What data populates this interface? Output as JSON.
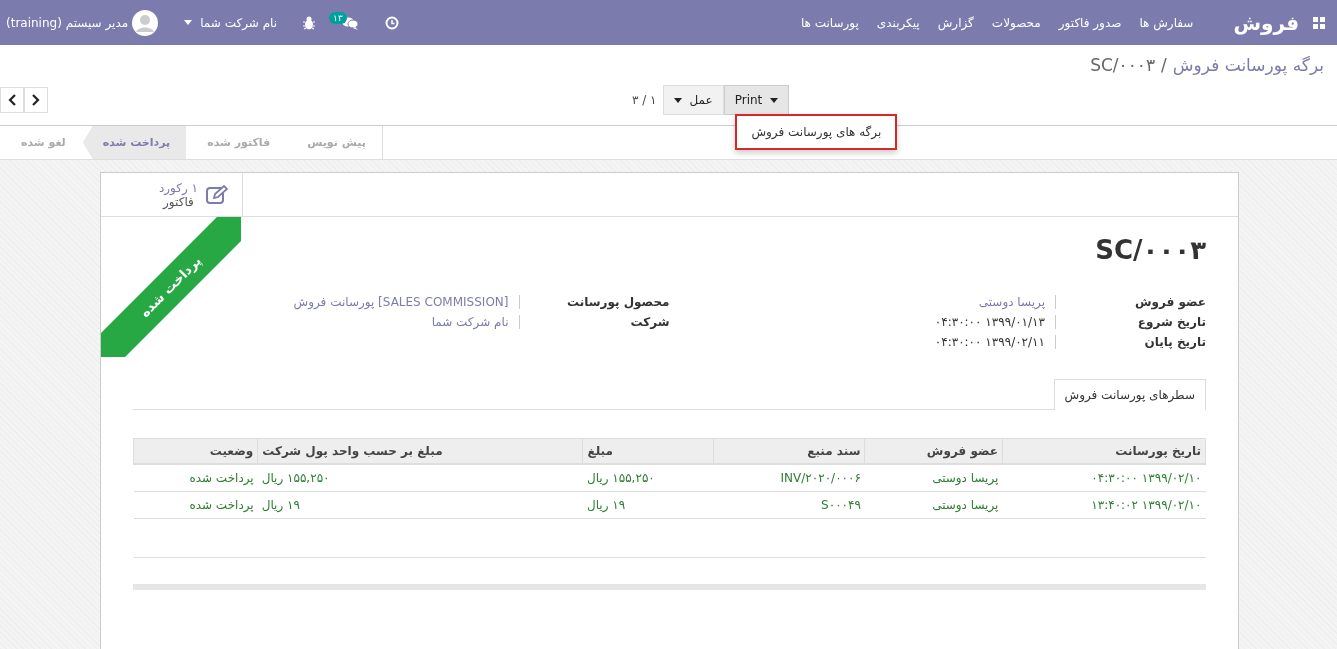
{
  "navbar": {
    "brand": "فروش",
    "menu": [
      "سفارش ها",
      "صدور فاکتور",
      "محصولات",
      "گزارش",
      "پیکربندی",
      "پورسانت ها"
    ],
    "message_count": "۱۳",
    "company": "نام شرکت شما",
    "user": "مدیر سیستم (training)"
  },
  "breadcrumb": {
    "parent": "برگه پورسانت فروش",
    "separator": "/",
    "current": "SC/۰۰۰۳"
  },
  "buttons": {
    "print": "Print",
    "action": "عمل"
  },
  "print_menu": {
    "items": [
      "برگه های پورسانت فروش"
    ]
  },
  "pager": {
    "value": "۱ / ۳"
  },
  "stages": [
    {
      "label": "پیش نویس",
      "selected": false
    },
    {
      "label": "فاکتور شده",
      "selected": false
    },
    {
      "label": "پرداخت شده",
      "selected": true
    },
    {
      "label": "لغو شده",
      "selected": false
    }
  ],
  "smart_button": {
    "count": "۱ رکورد",
    "label": "فاکتور"
  },
  "ribbon": {
    "text": "پرداخت شده"
  },
  "title": "SC/۰۰۰۳",
  "right_fields": [
    {
      "label": "عضو فروش",
      "value": "پریسا دوستی",
      "kind": "link"
    },
    {
      "label": "تاریخ شروع",
      "value": "۱۳۹۹/۰۱/۱۳ ۰۴:۳۰:۰۰",
      "kind": "text"
    },
    {
      "label": "تاریخ پایان",
      "value": "۱۳۹۹/۰۲/۱۱ ۰۴:۳۰:۰۰",
      "kind": "text"
    }
  ],
  "left_fields": [
    {
      "label": "محصول پورسانت",
      "value": "[SALES COMMISSION] پورسانت فروش",
      "kind": "link"
    },
    {
      "label": "شرکت",
      "value": "نام شرکت شما",
      "kind": "link"
    }
  ],
  "tabs": [
    {
      "label": "سطرهای پورسانت فروش",
      "selected": true
    }
  ],
  "table": {
    "columns": [
      {
        "label": "تاریخ پورسانت",
        "kind": "text"
      },
      {
        "label": "عضو فروش",
        "kind": "text"
      },
      {
        "label": "سند منبع",
        "kind": "text"
      },
      {
        "label": "مبلغ",
        "kind": "monetary"
      },
      {
        "label": "مبلغ بر حسب واحد پول شرکت",
        "kind": "monetary"
      },
      {
        "label": "وضعیت",
        "kind": "text"
      }
    ],
    "rows": [
      [
        "۱۳۹۹/۰۲/۱۰ ۰۴:۳۰:۰۰",
        "پریسا دوستی",
        "INV/۲۰۲۰/۰۰۰۶",
        "۱۵۵,۲۵۰ ریال",
        "۱۵۵,۲۵۰ ریال",
        "پرداخت شده"
      ],
      [
        "۱۳۹۹/۰۲/۱۰ ۱۳:۴۰:۰۲",
        "پریسا دوستی",
        "S۰۰۰۴۹",
        "۱۹ ریال",
        "۱۹ ریال",
        "پرداخت شده"
      ]
    ]
  }
}
